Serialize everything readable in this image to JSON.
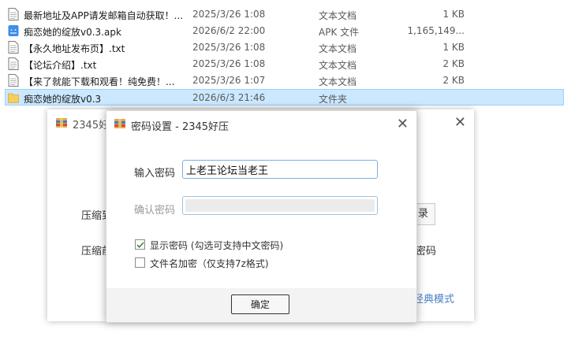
{
  "files": [
    {
      "name": "最新地址及APP请发邮箱自动获取！...",
      "date": "2025/3/26 1:08",
      "type": "文本文档",
      "size": "1 KB",
      "icon": "text-file-icon"
    },
    {
      "name": "痴恋她的绽放v0.3.apk",
      "date": "2026/6/2 22:00",
      "type": "APK 文件",
      "size": "1,165,149...",
      "icon": "apk-file-icon"
    },
    {
      "name": "【永久地址发布页】.txt",
      "date": "2025/3/26 1:08",
      "type": "文本文档",
      "size": "1 KB",
      "icon": "text-file-icon"
    },
    {
      "name": "【论坛介绍】.txt",
      "date": "2025/3/26 1:08",
      "type": "文本文档",
      "size": "2 KB",
      "icon": "text-file-icon"
    },
    {
      "name": "【来了就能下载和观看！纯免费！...",
      "date": "2025/3/26 1:07",
      "type": "文本文档",
      "size": "2 KB",
      "icon": "text-file-icon"
    },
    {
      "name": "痴恋她的绽放v0.3",
      "date": "2026/6/3 21:46",
      "type": "文件夹",
      "size": "",
      "icon": "folder-icon"
    }
  ],
  "bg_window": {
    "title": "2345好",
    "label1": "压缩到",
    "label2": "压缩前",
    "button_fragment": "录",
    "text_fragment": "密码",
    "mode_link": "经典模式"
  },
  "dialog": {
    "title": "密码设置 - 2345好压",
    "password_label": "输入密码",
    "password_value": "上老王论坛当老王",
    "confirm_label": "确认密码",
    "show_password_label": "显示密码 (勾选可支持中文密码)",
    "show_password_checked": true,
    "encrypt_filename_label": "文件名加密（仅支持7z格式)",
    "encrypt_filename_checked": false,
    "ok_label": "确定"
  },
  "colors": {
    "selection": "#cce8ff",
    "input_border": "#7ab0e0",
    "link": "#4a7fc6",
    "check": "#3a8a3a"
  }
}
